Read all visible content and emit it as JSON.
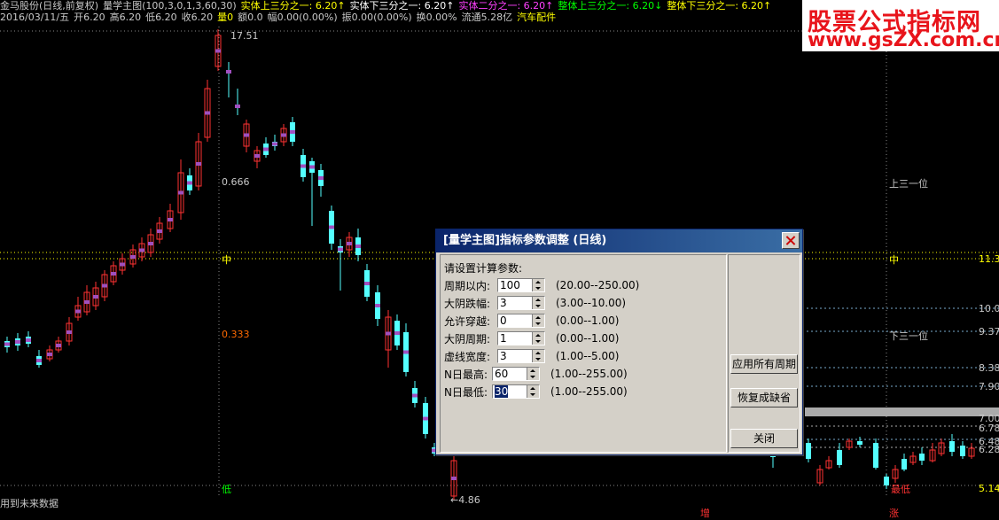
{
  "header": {
    "line1": [
      {
        "text": "金马股份(日线,前复权)",
        "color": "#c8c8c8"
      },
      {
        "text": "量学主图(100,3,0,1,3,60,30)",
        "color": "#c8c8c8"
      },
      {
        "text": "实体上三分之一: 6.20↑",
        "color": "#ffff00"
      },
      {
        "text": "实体下三分之一: 6.20↑",
        "color": "#ffffff"
      },
      {
        "text": "实体二分之一: 6.20↑",
        "color": "#ff40ff"
      },
      {
        "text": "整体上三分之一: 6.20↓",
        "color": "#00ff00"
      },
      {
        "text": "整体下三分之一: 6.20↑",
        "color": "#ffff00"
      }
    ],
    "line2": [
      {
        "text": "2016/03/11/五",
        "color": "#c8c8c8"
      },
      {
        "text": "开6.20",
        "color": "#c8c8c8"
      },
      {
        "text": "高6.20",
        "color": "#c8c8c8"
      },
      {
        "text": "低6.20",
        "color": "#c8c8c8"
      },
      {
        "text": "收6.20",
        "color": "#c8c8c8"
      },
      {
        "text": "量0",
        "color": "#ffff00"
      },
      {
        "text": "额0.0",
        "color": "#c8c8c8"
      },
      {
        "text": "幅0.00(0.00%)",
        "color": "#c8c8c8"
      },
      {
        "text": "振0.00(0.00%)",
        "color": "#c8c8c8"
      },
      {
        "text": "换0.00%",
        "color": "#c8c8c8"
      },
      {
        "text": "流通5.28亿",
        "color": "#c8c8c8"
      },
      {
        "text": "汽车配件",
        "color": "#ffff00"
      }
    ]
  },
  "watermark": {
    "title": "股票公式指标网",
    "url": "www.gsZX.com.cn"
  },
  "chart_labels": {
    "high_price": "17.51",
    "low_price": "←4.86",
    "fib_upper": "0.666",
    "fib_lower": "0.333",
    "mid_left": "中",
    "low_marker": "低",
    "right_upper": "上三一位",
    "right_mid": "中",
    "right_lower": "下三一位",
    "zeng": "增",
    "zhang": "涨",
    "zuidi": "最低",
    "future": "用到未来数据"
  },
  "right_axis": [
    "11.3",
    "10.0",
    "9.37",
    "8.38",
    "7.90",
    "7.00",
    "6.78",
    "6.48",
    "6.28",
    "5.14"
  ],
  "dialog": {
    "title": "[量学主图]指标参数调整 (日线)",
    "prompt": "请设置计算参数:",
    "params": [
      {
        "name": "周期以内:",
        "value": "100",
        "range": "(20.00--250.00)"
      },
      {
        "name": "大阴跌幅:",
        "value": "3",
        "range": "(3.00--10.00)"
      },
      {
        "name": "允许穿越:",
        "value": "0",
        "range": "(0.00--1.00)"
      },
      {
        "name": "大阴周期:",
        "value": "1",
        "range": "(0.00--1.00)"
      },
      {
        "name": "虚线宽度:",
        "value": "3",
        "range": "(1.00--5.00)"
      },
      {
        "name": "N日最高:",
        "value": "60",
        "range": "(1.00--255.00)"
      },
      {
        "name": "N日最低:",
        "value": "30",
        "range": "(1.00--255.00)"
      }
    ],
    "buttons": {
      "apply_all": "应用所有周期",
      "restore": "恢复成缺省",
      "close": "关闭"
    }
  },
  "colors": {
    "up": "#ff3232",
    "down": "#54ffff",
    "bg": "#000000",
    "watermark": "#e8141b",
    "titlebar": "#0a246a"
  }
}
